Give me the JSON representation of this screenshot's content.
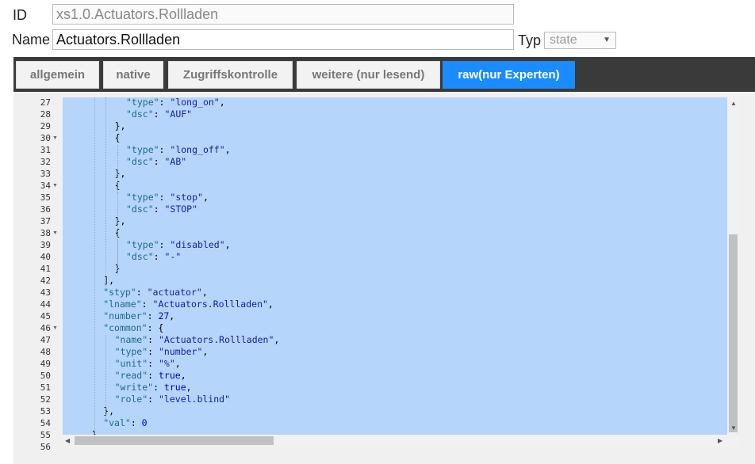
{
  "form": {
    "id_label": "ID",
    "id_value": "xs1.0.Actuators.Rollladen",
    "name_label": "Name",
    "name_value": "Actuators.Rollladen",
    "type_label": "Typ",
    "type_value": "state"
  },
  "tabs": [
    {
      "label": "allgemein",
      "active": false
    },
    {
      "label": "native",
      "active": false
    },
    {
      "label": "Zugriffskontrolle",
      "active": false
    },
    {
      "label": "weitere (nur lesend)",
      "active": false
    },
    {
      "label": "raw(nur Experten)",
      "active": true
    }
  ],
  "editor": {
    "lines": [
      {
        "n": "27",
        "fold": false,
        "indent": 10,
        "t": [
          [
            "k",
            "\"type\""
          ],
          [
            "p",
            ": "
          ],
          [
            "s",
            "\"long_on\""
          ],
          [
            "p",
            ","
          ]
        ]
      },
      {
        "n": "28",
        "fold": false,
        "indent": 10,
        "t": [
          [
            "k",
            "\"dsc\""
          ],
          [
            "p",
            ": "
          ],
          [
            "s",
            "\"AUF\""
          ]
        ]
      },
      {
        "n": "29",
        "fold": false,
        "indent": 8,
        "t": [
          [
            "p",
            "},"
          ]
        ]
      },
      {
        "n": "30",
        "fold": true,
        "indent": 8,
        "t": [
          [
            "p",
            "{"
          ]
        ]
      },
      {
        "n": "31",
        "fold": false,
        "indent": 10,
        "t": [
          [
            "k",
            "\"type\""
          ],
          [
            "p",
            ": "
          ],
          [
            "s",
            "\"long_off\""
          ],
          [
            "p",
            ","
          ]
        ]
      },
      {
        "n": "32",
        "fold": false,
        "indent": 10,
        "t": [
          [
            "k",
            "\"dsc\""
          ],
          [
            "p",
            ": "
          ],
          [
            "s",
            "\"AB\""
          ]
        ]
      },
      {
        "n": "33",
        "fold": false,
        "indent": 8,
        "t": [
          [
            "p",
            "},"
          ]
        ]
      },
      {
        "n": "34",
        "fold": true,
        "indent": 8,
        "t": [
          [
            "p",
            "{"
          ]
        ]
      },
      {
        "n": "35",
        "fold": false,
        "indent": 10,
        "t": [
          [
            "k",
            "\"type\""
          ],
          [
            "p",
            ": "
          ],
          [
            "s",
            "\"stop\""
          ],
          [
            "p",
            ","
          ]
        ]
      },
      {
        "n": "36",
        "fold": false,
        "indent": 10,
        "t": [
          [
            "k",
            "\"dsc\""
          ],
          [
            "p",
            ": "
          ],
          [
            "s",
            "\"STOP\""
          ]
        ]
      },
      {
        "n": "37",
        "fold": false,
        "indent": 8,
        "t": [
          [
            "p",
            "},"
          ]
        ]
      },
      {
        "n": "38",
        "fold": true,
        "indent": 8,
        "t": [
          [
            "p",
            "{"
          ]
        ]
      },
      {
        "n": "39",
        "fold": false,
        "indent": 10,
        "t": [
          [
            "k",
            "\"type\""
          ],
          [
            "p",
            ": "
          ],
          [
            "s",
            "\"disabled\""
          ],
          [
            "p",
            ","
          ]
        ]
      },
      {
        "n": "40",
        "fold": false,
        "indent": 10,
        "t": [
          [
            "k",
            "\"dsc\""
          ],
          [
            "p",
            ": "
          ],
          [
            "s",
            "\"-\""
          ]
        ]
      },
      {
        "n": "41",
        "fold": false,
        "indent": 8,
        "t": [
          [
            "p",
            "}"
          ]
        ]
      },
      {
        "n": "42",
        "fold": false,
        "indent": 6,
        "t": [
          [
            "p",
            "],"
          ]
        ]
      },
      {
        "n": "43",
        "fold": false,
        "indent": 6,
        "t": [
          [
            "k",
            "\"styp\""
          ],
          [
            "p",
            ": "
          ],
          [
            "s",
            "\"actuator\""
          ],
          [
            "p",
            ","
          ]
        ]
      },
      {
        "n": "44",
        "fold": false,
        "indent": 6,
        "t": [
          [
            "k",
            "\"lname\""
          ],
          [
            "p",
            ": "
          ],
          [
            "s",
            "\"Actuators.Rollladen\""
          ],
          [
            "p",
            ","
          ]
        ]
      },
      {
        "n": "45",
        "fold": false,
        "indent": 6,
        "t": [
          [
            "k",
            "\"number\""
          ],
          [
            "p",
            ": "
          ],
          [
            "n",
            "27"
          ],
          [
            "p",
            ","
          ]
        ]
      },
      {
        "n": "46",
        "fold": true,
        "indent": 6,
        "t": [
          [
            "k",
            "\"common\""
          ],
          [
            "p",
            ": {"
          ]
        ]
      },
      {
        "n": "47",
        "fold": false,
        "indent": 8,
        "t": [
          [
            "k",
            "\"name\""
          ],
          [
            "p",
            ": "
          ],
          [
            "s",
            "\"Actuators.Rollladen\""
          ],
          [
            "p",
            ","
          ]
        ]
      },
      {
        "n": "48",
        "fold": false,
        "indent": 8,
        "t": [
          [
            "k",
            "\"type\""
          ],
          [
            "p",
            ": "
          ],
          [
            "s",
            "\"number\""
          ],
          [
            "p",
            ","
          ]
        ]
      },
      {
        "n": "49",
        "fold": false,
        "indent": 8,
        "t": [
          [
            "k",
            "\"unit\""
          ],
          [
            "p",
            ": "
          ],
          [
            "s",
            "\"%\""
          ],
          [
            "p",
            ","
          ]
        ]
      },
      {
        "n": "50",
        "fold": false,
        "indent": 8,
        "t": [
          [
            "k",
            "\"read\""
          ],
          [
            "p",
            ": "
          ],
          [
            "b",
            "true"
          ],
          [
            "p",
            ","
          ]
        ]
      },
      {
        "n": "51",
        "fold": false,
        "indent": 8,
        "t": [
          [
            "k",
            "\"write\""
          ],
          [
            "p",
            ": "
          ],
          [
            "b",
            "true"
          ],
          [
            "p",
            ","
          ]
        ]
      },
      {
        "n": "52",
        "fold": false,
        "indent": 8,
        "t": [
          [
            "k",
            "\"role\""
          ],
          [
            "p",
            ": "
          ],
          [
            "s",
            "\"level.blind\""
          ]
        ]
      },
      {
        "n": "53",
        "fold": false,
        "indent": 6,
        "t": [
          [
            "p",
            "},"
          ]
        ]
      },
      {
        "n": "54",
        "fold": false,
        "indent": 6,
        "t": [
          [
            "k",
            "\"val\""
          ],
          [
            "p",
            ": "
          ],
          [
            "n",
            "0"
          ]
        ]
      },
      {
        "n": "55",
        "fold": false,
        "indent": 4,
        "t": [
          [
            "p",
            "}"
          ]
        ]
      },
      {
        "n": "56",
        "fold": false,
        "indent": 0,
        "t": []
      }
    ]
  }
}
